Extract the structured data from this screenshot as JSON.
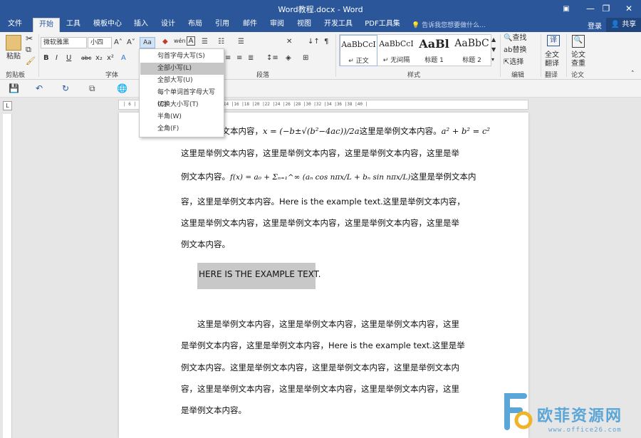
{
  "window": {
    "title": "Word教程.docx - Word",
    "ribbon_display_icon": "ribbon-display-icon",
    "minimize": "—",
    "restore": "❐",
    "close": "✕"
  },
  "tabs": [
    {
      "label": "文件"
    },
    {
      "label": "开始"
    },
    {
      "label": "工具"
    },
    {
      "label": "模板中心"
    },
    {
      "label": "插入"
    },
    {
      "label": "设计"
    },
    {
      "label": "布局"
    },
    {
      "label": "引用"
    },
    {
      "label": "邮件"
    },
    {
      "label": "审阅"
    },
    {
      "label": "视图"
    },
    {
      "label": "开发工具"
    },
    {
      "label": "PDF工具集"
    }
  ],
  "tellme": "告诉我您想要做什么...",
  "account": {
    "login": "登录",
    "share": "共享"
  },
  "ribbon": {
    "clipboard": {
      "label": "剪贴板",
      "paste": "粘贴"
    },
    "font": {
      "label": "字体",
      "name": "微软雅黑",
      "size": "小四",
      "change_case": "Aa"
    },
    "paragraph": {
      "label": "段落"
    },
    "styles": {
      "label": "样式",
      "items": [
        {
          "preview": "AaBbCcI",
          "name": "↵ 正文"
        },
        {
          "preview": "AaBbCcI",
          "name": "↵ 无间隔"
        },
        {
          "preview": "AaBl",
          "name": "标题 1"
        },
        {
          "preview": "AaBbC",
          "name": "标题 2"
        }
      ]
    },
    "editing": {
      "label": "编辑",
      "find": "查找",
      "replace": "替换",
      "select": "选择"
    },
    "translate": {
      "label": "翻译",
      "line1": "全文",
      "line2": "翻译"
    },
    "paper": {
      "label": "论文",
      "line1": "论文",
      "line2": "查重"
    }
  },
  "change_case_menu": {
    "items": [
      {
        "label": "句首字母大写(S)",
        "active": false
      },
      {
        "label": "全部小写(L)",
        "active": true
      },
      {
        "label": "全部大写(U)",
        "active": false
      },
      {
        "label": "每个单词首字母大写(C)",
        "active": false
      },
      {
        "label": "切换大小写(T)",
        "active": false
      },
      {
        "label": "半角(W)",
        "active": false
      },
      {
        "label": "全角(F)",
        "active": false
      }
    ]
  },
  "ruler": {
    "text": "| 6 | 4 | 2 |    | 2 | 4 | 6 | 8 |10 |12 |14 |16 |18 |20 |22 |24 |26 |28 |30 |32 |34 |36 |38 |40 |"
  },
  "document": {
    "line1": {
      "pre": "这里是举例文本内容，",
      "math1": "x = (−b±√(b²−4ac))/2a",
      "mid": "这里是举例文本内容。",
      "math2": "a² + b² = c²"
    },
    "line2": "这里是举例文本内容，这里是举例文本内容，这里是举例文本内容，这里是举",
    "line3": {
      "pre": "例文本内容。",
      "math": "f(x) = a₀ + Σₙ₌₁^∞ (aₙ cos nπx/L + bₙ sin nπx/L)",
      "post": "这里是举例文本内"
    },
    "line4": "容，这里是举例文本内容。Here is the example text.这里是举例文本内容，",
    "line5": "这里是举例文本内容，这里是举例文本内容，这里是举例文本内容，这里是举",
    "line6": "例文本内容。",
    "highlight": "HERE IS THE EXAMPLE TEXT.",
    "para2": [
      "这里是举例文本内容，这里是举例文本内容，这里是举例文本内容，这里",
      "是举例文本内容，这里是举例文本内容，Here is the example text.这里是举",
      "例文本内容。这里是举例文本内容，这里是举例文本内容，这里是举例文本内",
      "容，这里是举例文本内容，这里是举例文本内容，这里是举例文本内容，这里",
      "是举例文本内容。"
    ]
  },
  "watermark": {
    "text": "欧菲资源网",
    "url": "www.office26.com"
  }
}
